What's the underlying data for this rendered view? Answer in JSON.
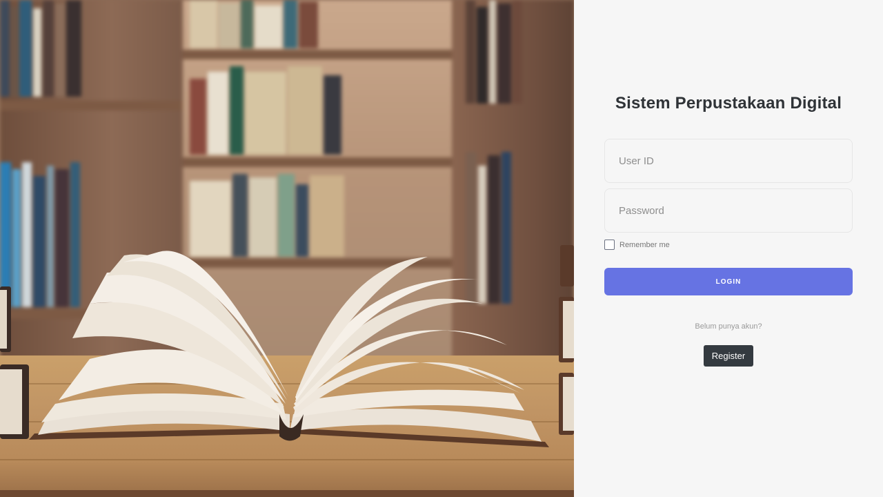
{
  "app": {
    "title": "Sistem Perpustakaan Digital"
  },
  "login_form": {
    "user_id_placeholder": "User ID",
    "user_id_value": "",
    "password_placeholder": "Password",
    "password_value": "",
    "remember_label": "Remember me",
    "remember_checked": false,
    "login_label": "LOGIN"
  },
  "register": {
    "prompt": "Belum punya akun?",
    "button_label": "Register"
  },
  "hero": {
    "image": "open-book-library-background"
  },
  "colors": {
    "login_button": "#6673e3",
    "register_button": "#343a40",
    "panel_background": "#f6f6f6",
    "title_text": "#2f3337"
  }
}
